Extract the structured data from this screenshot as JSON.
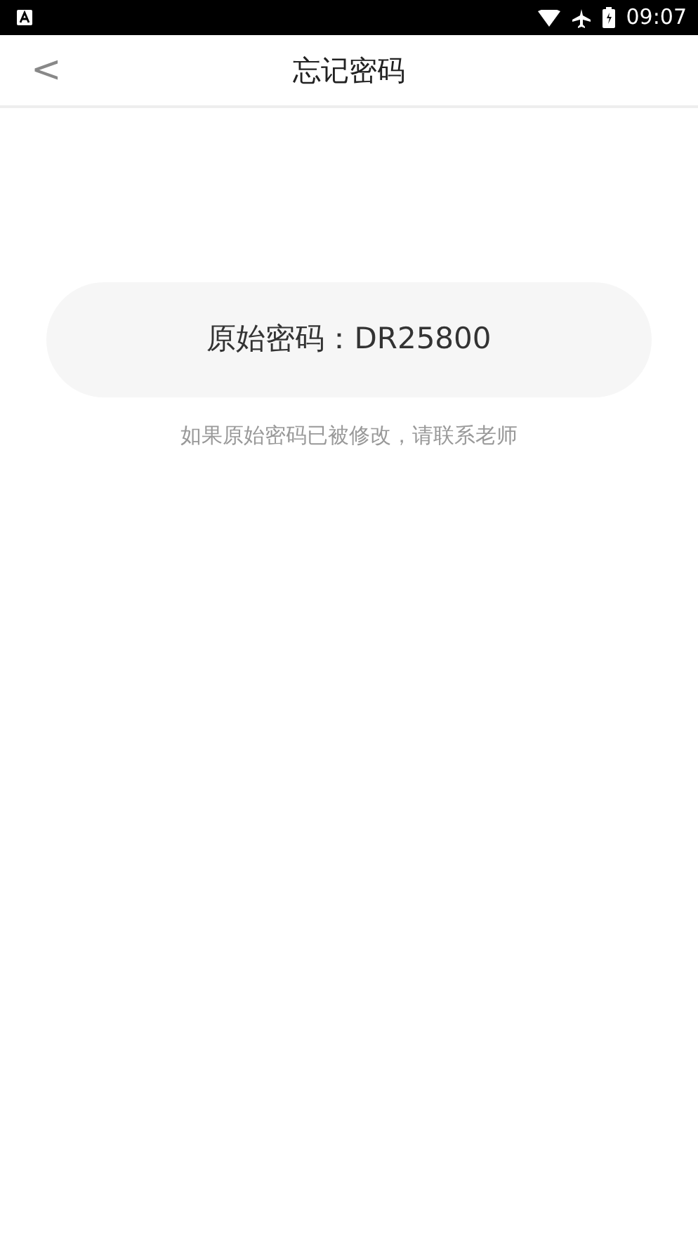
{
  "status_bar": {
    "time": "09:07"
  },
  "header": {
    "back": "<",
    "title": "忘记密码"
  },
  "password_card": {
    "text": "原始密码：DR25800"
  },
  "hint": "如果原始密码已被修改，请联系老师"
}
